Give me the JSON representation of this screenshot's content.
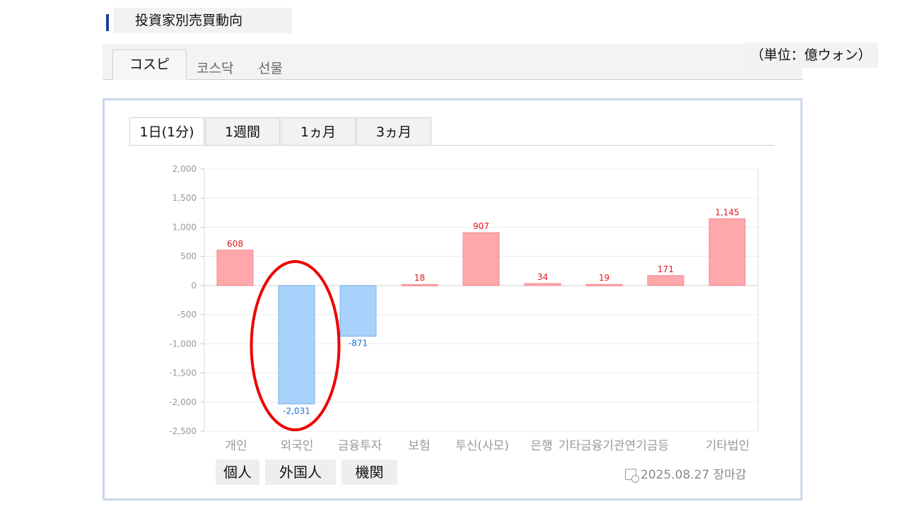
{
  "header": {
    "title": "投資家別売買動向"
  },
  "market_tabs": [
    {
      "label": "コスピ",
      "active": true
    },
    {
      "label": "코스닥",
      "active": false
    },
    {
      "label": "선물",
      "active": false
    }
  ],
  "unit_label": "（単位：億ウォン）",
  "period_tabs": [
    {
      "label": "1日(1分)",
      "active": true
    },
    {
      "label": "1週間",
      "active": false
    },
    {
      "label": "1ヵ月",
      "active": false
    },
    {
      "label": "3ヵ月",
      "active": false
    }
  ],
  "japanese_labels": [
    "個人",
    "外国人",
    "機関"
  ],
  "footer": {
    "date": "2025.08.27 장마감"
  },
  "colors": {
    "positive_fill": "#ffa8ac",
    "negative_fill": "#a8d1fb",
    "positive_label": "#e8131f",
    "negative_label": "#1f6fd6",
    "highlight": "#ee0000"
  },
  "chart_data": {
    "type": "bar",
    "categories": [
      "개인",
      "외국인",
      "금융투자",
      "보험",
      "투신(사모)",
      "은행",
      "기타금융",
      "기관연기금등",
      "기타법인"
    ],
    "category_labels": [
      "개인",
      "외국인",
      "금융투자",
      "보험",
      "투신(사모)",
      "은행",
      "기타금융기관연기금등",
      "기타법인"
    ],
    "values": [
      608,
      -2031,
      -871,
      18,
      907,
      34,
      19,
      171,
      1145
    ],
    "value_labels": [
      "608",
      "-2,031",
      "-871",
      "18",
      "907",
      "34",
      "19",
      "171",
      "1,145"
    ],
    "ylim": [
      -2500,
      2000
    ],
    "yticks": [
      2000,
      1500,
      1000,
      500,
      0,
      -500,
      -1000,
      -1500,
      -2000,
      -2500
    ],
    "ytick_labels": [
      "2,000",
      "1,500",
      "1,000",
      "500",
      "0",
      "-500",
      "-1,000",
      "-1,500",
      "-2,000",
      "-2,500"
    ],
    "grid": true,
    "highlighted_category": "외국인"
  }
}
